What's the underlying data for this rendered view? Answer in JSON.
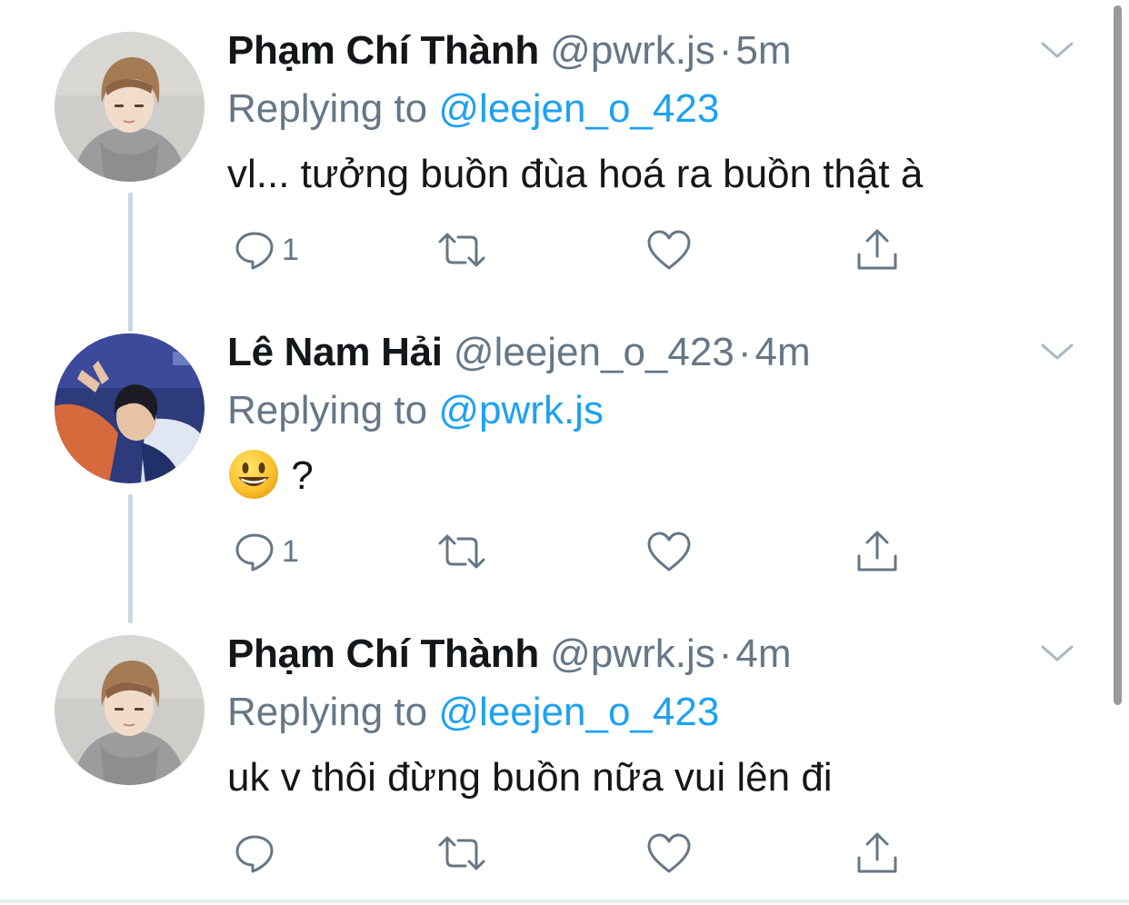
{
  "tweets": [
    {
      "name": "Phạm Chí Thành",
      "handle": "@pwrk.js",
      "separator": "·",
      "time": "5m",
      "replying_prefix": "Replying to",
      "replying_to": "@leejen_o_423",
      "text": "vl... tưởng buồn đùa hoá ra buồn thật à",
      "reply_count": "1",
      "avatar_icon": "avatar-boy-hoodie"
    },
    {
      "name": "Lê Nam Hải",
      "handle": "@leejen_o_423",
      "separator": "·",
      "time": "4m",
      "replying_prefix": "Replying to",
      "replying_to": "@pwrk.js",
      "text_emoji": "smiley-emoji",
      "text": "?",
      "reply_count": "1",
      "avatar_icon": "avatar-blue-jacket"
    },
    {
      "name": "Phạm Chí Thành",
      "handle": "@pwrk.js",
      "separator": "·",
      "time": "4m",
      "replying_prefix": "Replying to",
      "replying_to": "@leejen_o_423",
      "text": "uk v thôi đừng buồn nữa vui lên đi",
      "reply_count": "",
      "avatar_icon": "avatar-boy-hoodie"
    }
  ],
  "colors": {
    "text": "#14171a",
    "secondary": "#657786",
    "link": "#1da1f2",
    "thread_line": "#ccd6dd"
  },
  "icons": {
    "reply": "reply-icon",
    "retweet": "retweet-icon",
    "like": "heart-icon",
    "share": "share-icon",
    "more": "chevron-down-icon"
  }
}
